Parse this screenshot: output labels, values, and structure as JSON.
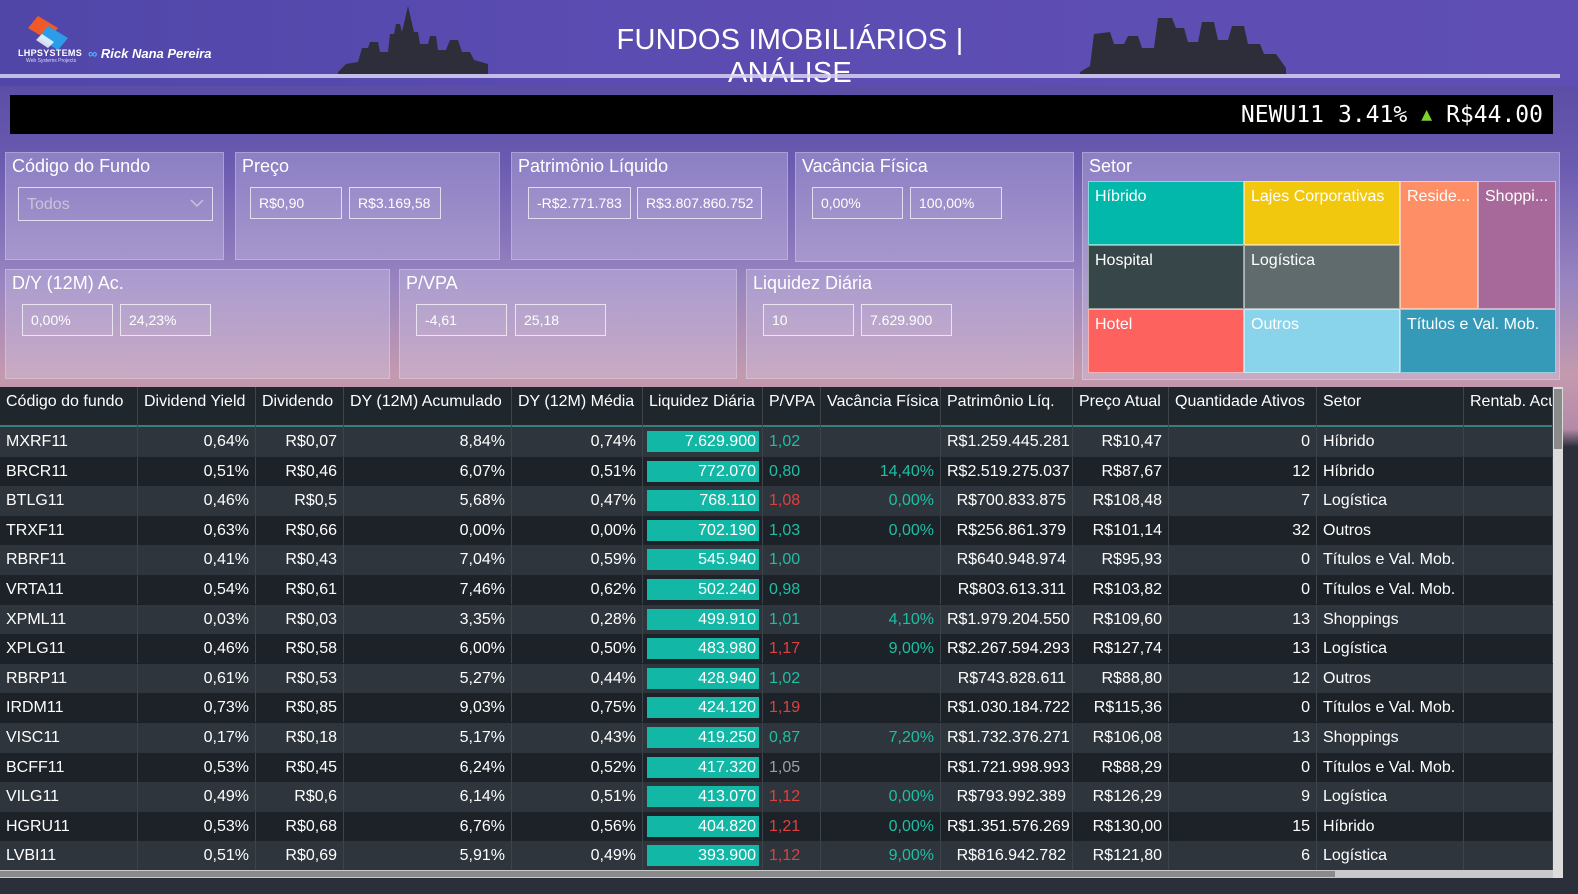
{
  "header": {
    "logo_text": "LHPSYSTEMS",
    "logo_sub": "Web Systems Projects",
    "author": "Rick Nana Pereira",
    "title": "FUNDOS IMOBILIÁRIOS | ANÁLISE"
  },
  "ticker": {
    "code": "NEWU11",
    "change": "3.41%",
    "arrow": "▲",
    "price": "R$44.00"
  },
  "filters": {
    "codigo": {
      "title": "Código do Fundo",
      "value": "Todos"
    },
    "preco": {
      "title": "Preço",
      "min": "R$0,90",
      "max": "R$3.169,58"
    },
    "patrimonio": {
      "title": "Patrimônio Líquido",
      "min": "-R$2.771.783",
      "max": "R$3.807.860.752"
    },
    "vacancia": {
      "title": "Vacância Física",
      "min": "0,00%",
      "max": "100,00%"
    },
    "dy": {
      "title": "D/Y (12M) Ac.",
      "min": "0,00%",
      "max": "24,23%"
    },
    "pvpa": {
      "title": "P/VPA",
      "min": "-4,61",
      "max": "25,18"
    },
    "liquidez": {
      "title": "Liquidez Diária",
      "min": "10",
      "max": "7.629.900"
    }
  },
  "setor": {
    "title": "Setor",
    "items": [
      {
        "label": "Híbrido",
        "color": "#01b8aa"
      },
      {
        "label": "Lajes Corporativas",
        "color": "#f2c80f"
      },
      {
        "label": "Reside...",
        "color": "#fd8e66"
      },
      {
        "label": "Shoppi...",
        "color": "#a66999"
      },
      {
        "label": "Hospital",
        "color": "#374649"
      },
      {
        "label": "Logística",
        "color": "#5f6b6d"
      },
      {
        "label": "Hotel",
        "color": "#fd625e"
      },
      {
        "label": "Outros",
        "color": "#8ad4eb"
      },
      {
        "label": "Títulos e Val. Mob.",
        "color": "#3599b8"
      }
    ]
  },
  "table": {
    "columns": [
      "Código do fundo",
      "Dividend Yield",
      "Dividendo",
      "DY (12M) Acumulado",
      "DY (12M) Média",
      "Liquidez Diária",
      "P/VPA",
      "Vacância Física",
      "Patrimônio Líq.",
      "Preço Atual",
      "Quantidade Ativos",
      "Setor",
      "Rentab. Acu"
    ],
    "rows": [
      {
        "codigo": "MXRF11",
        "dy": "0,64%",
        "div": "R$0,07",
        "dyac": "8,84%",
        "dymed": "0,74%",
        "liq": "7.629.900",
        "liq_frac": 1.0,
        "pvpa": "1,02",
        "pvpa_c": "green",
        "vac": "",
        "vac_c": "green",
        "pat": "R$1.259.445.281",
        "preco": "R$10,47",
        "qtd": "0",
        "setor": "Híbrido"
      },
      {
        "codigo": "BRCR11",
        "dy": "0,51%",
        "div": "R$0,46",
        "dyac": "6,07%",
        "dymed": "0,51%",
        "liq": "772.070",
        "liq_frac": 1.0,
        "pvpa": "0,80",
        "pvpa_c": "green",
        "vac": "14,40%",
        "vac_c": "green",
        "pat": "R$2.519.275.037",
        "preco": "R$87,67",
        "qtd": "12",
        "setor": "Híbrido"
      },
      {
        "codigo": "BTLG11",
        "dy": "0,46%",
        "div": "R$0,5",
        "dyac": "5,68%",
        "dymed": "0,47%",
        "liq": "768.110",
        "liq_frac": 1.0,
        "pvpa": "1,08",
        "pvpa_c": "red",
        "vac": "0,00%",
        "vac_c": "green",
        "pat": "R$700.833.875",
        "preco": "R$108,48",
        "qtd": "7",
        "setor": "Logística"
      },
      {
        "codigo": "TRXF11",
        "dy": "0,63%",
        "div": "R$0,66",
        "dyac": "0,00%",
        "dymed": "0,00%",
        "liq": "702.190",
        "liq_frac": 1.0,
        "pvpa": "1,03",
        "pvpa_c": "green",
        "vac": "0,00%",
        "vac_c": "green",
        "pat": "R$256.861.379",
        "preco": "R$101,14",
        "qtd": "32",
        "setor": "Outros"
      },
      {
        "codigo": "RBRF11",
        "dy": "0,41%",
        "div": "R$0,43",
        "dyac": "7,04%",
        "dymed": "0,59%",
        "liq": "545.940",
        "liq_frac": 1.0,
        "pvpa": "1,00",
        "pvpa_c": "green",
        "vac": "",
        "vac_c": "green",
        "pat": "R$640.948.974",
        "preco": "R$95,93",
        "qtd": "0",
        "setor": "Títulos e Val. Mob."
      },
      {
        "codigo": "VRTA11",
        "dy": "0,54%",
        "div": "R$0,61",
        "dyac": "7,46%",
        "dymed": "0,62%",
        "liq": "502.240",
        "liq_frac": 1.0,
        "pvpa": "0,98",
        "pvpa_c": "green",
        "vac": "",
        "vac_c": "green",
        "pat": "R$803.613.311",
        "preco": "R$103,82",
        "qtd": "0",
        "setor": "Títulos e Val. Mob."
      },
      {
        "codigo": "XPML11",
        "dy": "0,03%",
        "div": "R$0,03",
        "dyac": "3,35%",
        "dymed": "0,28%",
        "liq": "499.910",
        "liq_frac": 1.0,
        "pvpa": "1,01",
        "pvpa_c": "green",
        "vac": "4,10%",
        "vac_c": "green",
        "pat": "R$1.979.204.550",
        "preco": "R$109,60",
        "qtd": "13",
        "setor": "Shoppings"
      },
      {
        "codigo": "XPLG11",
        "dy": "0,46%",
        "div": "R$0,58",
        "dyac": "6,00%",
        "dymed": "0,50%",
        "liq": "483.980",
        "liq_frac": 1.0,
        "pvpa": "1,17",
        "pvpa_c": "red",
        "vac": "9,00%",
        "vac_c": "green",
        "pat": "R$2.267.594.293",
        "preco": "R$127,74",
        "qtd": "13",
        "setor": "Logística"
      },
      {
        "codigo": "RBRP11",
        "dy": "0,61%",
        "div": "R$0,53",
        "dyac": "5,27%",
        "dymed": "0,44%",
        "liq": "428.940",
        "liq_frac": 1.0,
        "pvpa": "1,02",
        "pvpa_c": "green",
        "vac": "",
        "vac_c": "green",
        "pat": "R$743.828.611",
        "preco": "R$88,80",
        "qtd": "12",
        "setor": "Outros"
      },
      {
        "codigo": "IRDM11",
        "dy": "0,73%",
        "div": "R$0,85",
        "dyac": "9,03%",
        "dymed": "0,75%",
        "liq": "424.120",
        "liq_frac": 1.0,
        "pvpa": "1,19",
        "pvpa_c": "red",
        "vac": "",
        "vac_c": "green",
        "pat": "R$1.030.184.722",
        "preco": "R$115,36",
        "qtd": "0",
        "setor": "Títulos e Val. Mob."
      },
      {
        "codigo": "VISC11",
        "dy": "0,17%",
        "div": "R$0,18",
        "dyac": "5,17%",
        "dymed": "0,43%",
        "liq": "419.250",
        "liq_frac": 1.0,
        "pvpa": "0,87",
        "pvpa_c": "green",
        "vac": "7,20%",
        "vac_c": "green",
        "pat": "R$1.732.376.271",
        "preco": "R$106,08",
        "qtd": "13",
        "setor": "Shoppings"
      },
      {
        "codigo": "BCFF11",
        "dy": "0,53%",
        "div": "R$0,45",
        "dyac": "6,24%",
        "dymed": "0,52%",
        "liq": "417.320",
        "liq_frac": 1.0,
        "pvpa": "1,05",
        "pvpa_c": "grey",
        "vac": "",
        "vac_c": "green",
        "pat": "R$1.721.998.993",
        "preco": "R$88,29",
        "qtd": "0",
        "setor": "Títulos e Val. Mob."
      },
      {
        "codigo": "VILG11",
        "dy": "0,49%",
        "div": "R$0,6",
        "dyac": "6,14%",
        "dymed": "0,51%",
        "liq": "413.070",
        "liq_frac": 1.0,
        "pvpa": "1,12",
        "pvpa_c": "red",
        "vac": "0,00%",
        "vac_c": "green",
        "pat": "R$793.992.389",
        "preco": "R$126,29",
        "qtd": "9",
        "setor": "Logística"
      },
      {
        "codigo": "HGRU11",
        "dy": "0,53%",
        "div": "R$0,68",
        "dyac": "6,76%",
        "dymed": "0,56%",
        "liq": "404.820",
        "liq_frac": 1.0,
        "pvpa": "1,21",
        "pvpa_c": "red",
        "vac": "0,00%",
        "vac_c": "green",
        "pat": "R$1.351.576.269",
        "preco": "R$130,00",
        "qtd": "15",
        "setor": "Híbrido"
      },
      {
        "codigo": "LVBI11",
        "dy": "0,51%",
        "div": "R$0,69",
        "dyac": "5,91%",
        "dymed": "0,49%",
        "liq": "393.900",
        "liq_frac": 1.0,
        "pvpa": "1,12",
        "pvpa_c": "red",
        "vac": "9,00%",
        "vac_c": "green",
        "pat": "R$816.942.782",
        "preco": "R$121,80",
        "qtd": "6",
        "setor": "Logística"
      }
    ]
  }
}
